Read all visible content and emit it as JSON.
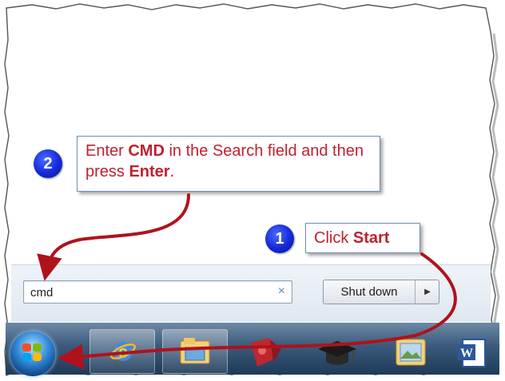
{
  "search": {
    "value": "cmd",
    "clear_glyph": "×"
  },
  "shutdown": {
    "label": "Shut down",
    "arrow_glyph": "▶"
  },
  "start_button": {
    "icon": "windows-start-orb"
  },
  "taskbar_items": [
    {
      "icon": "internet-explorer-icon"
    },
    {
      "icon": "windows-explorer-icon"
    },
    {
      "icon": "paint-bucket-icon"
    },
    {
      "icon": "graduation-cap-icon"
    },
    {
      "icon": "folder-image-icon"
    },
    {
      "icon": "word-icon",
      "letter": "W"
    }
  ],
  "callout_step2": {
    "badge": "2",
    "pre1": "Enter ",
    "bold1": "CMD",
    "mid": " in the Search field and then press ",
    "bold2": "Enter",
    "post": "."
  },
  "callout_step1": {
    "badge": "1",
    "pre": "Click ",
    "bold": "Start"
  },
  "colors": {
    "callout_text": "#c0202e",
    "arrow": "#b0121c",
    "badge": "#1428d8",
    "taskbar": "#2b4a6b"
  }
}
